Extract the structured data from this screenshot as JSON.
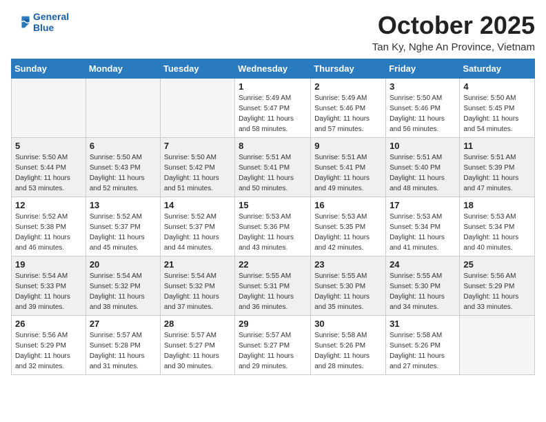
{
  "header": {
    "logo_line1": "General",
    "logo_line2": "Blue",
    "month": "October 2025",
    "location": "Tan Ky, Nghe An Province, Vietnam"
  },
  "weekdays": [
    "Sunday",
    "Monday",
    "Tuesday",
    "Wednesday",
    "Thursday",
    "Friday",
    "Saturday"
  ],
  "weeks": [
    {
      "shaded": false,
      "days": [
        {
          "num": "",
          "info": ""
        },
        {
          "num": "",
          "info": ""
        },
        {
          "num": "",
          "info": ""
        },
        {
          "num": "1",
          "info": "Sunrise: 5:49 AM\nSunset: 5:47 PM\nDaylight: 11 hours\nand 58 minutes."
        },
        {
          "num": "2",
          "info": "Sunrise: 5:49 AM\nSunset: 5:46 PM\nDaylight: 11 hours\nand 57 minutes."
        },
        {
          "num": "3",
          "info": "Sunrise: 5:50 AM\nSunset: 5:46 PM\nDaylight: 11 hours\nand 56 minutes."
        },
        {
          "num": "4",
          "info": "Sunrise: 5:50 AM\nSunset: 5:45 PM\nDaylight: 11 hours\nand 54 minutes."
        }
      ]
    },
    {
      "shaded": true,
      "days": [
        {
          "num": "5",
          "info": "Sunrise: 5:50 AM\nSunset: 5:44 PM\nDaylight: 11 hours\nand 53 minutes."
        },
        {
          "num": "6",
          "info": "Sunrise: 5:50 AM\nSunset: 5:43 PM\nDaylight: 11 hours\nand 52 minutes."
        },
        {
          "num": "7",
          "info": "Sunrise: 5:50 AM\nSunset: 5:42 PM\nDaylight: 11 hours\nand 51 minutes."
        },
        {
          "num": "8",
          "info": "Sunrise: 5:51 AM\nSunset: 5:41 PM\nDaylight: 11 hours\nand 50 minutes."
        },
        {
          "num": "9",
          "info": "Sunrise: 5:51 AM\nSunset: 5:41 PM\nDaylight: 11 hours\nand 49 minutes."
        },
        {
          "num": "10",
          "info": "Sunrise: 5:51 AM\nSunset: 5:40 PM\nDaylight: 11 hours\nand 48 minutes."
        },
        {
          "num": "11",
          "info": "Sunrise: 5:51 AM\nSunset: 5:39 PM\nDaylight: 11 hours\nand 47 minutes."
        }
      ]
    },
    {
      "shaded": false,
      "days": [
        {
          "num": "12",
          "info": "Sunrise: 5:52 AM\nSunset: 5:38 PM\nDaylight: 11 hours\nand 46 minutes."
        },
        {
          "num": "13",
          "info": "Sunrise: 5:52 AM\nSunset: 5:37 PM\nDaylight: 11 hours\nand 45 minutes."
        },
        {
          "num": "14",
          "info": "Sunrise: 5:52 AM\nSunset: 5:37 PM\nDaylight: 11 hours\nand 44 minutes."
        },
        {
          "num": "15",
          "info": "Sunrise: 5:53 AM\nSunset: 5:36 PM\nDaylight: 11 hours\nand 43 minutes."
        },
        {
          "num": "16",
          "info": "Sunrise: 5:53 AM\nSunset: 5:35 PM\nDaylight: 11 hours\nand 42 minutes."
        },
        {
          "num": "17",
          "info": "Sunrise: 5:53 AM\nSunset: 5:34 PM\nDaylight: 11 hours\nand 41 minutes."
        },
        {
          "num": "18",
          "info": "Sunrise: 5:53 AM\nSunset: 5:34 PM\nDaylight: 11 hours\nand 40 minutes."
        }
      ]
    },
    {
      "shaded": true,
      "days": [
        {
          "num": "19",
          "info": "Sunrise: 5:54 AM\nSunset: 5:33 PM\nDaylight: 11 hours\nand 39 minutes."
        },
        {
          "num": "20",
          "info": "Sunrise: 5:54 AM\nSunset: 5:32 PM\nDaylight: 11 hours\nand 38 minutes."
        },
        {
          "num": "21",
          "info": "Sunrise: 5:54 AM\nSunset: 5:32 PM\nDaylight: 11 hours\nand 37 minutes."
        },
        {
          "num": "22",
          "info": "Sunrise: 5:55 AM\nSunset: 5:31 PM\nDaylight: 11 hours\nand 36 minutes."
        },
        {
          "num": "23",
          "info": "Sunrise: 5:55 AM\nSunset: 5:30 PM\nDaylight: 11 hours\nand 35 minutes."
        },
        {
          "num": "24",
          "info": "Sunrise: 5:55 AM\nSunset: 5:30 PM\nDaylight: 11 hours\nand 34 minutes."
        },
        {
          "num": "25",
          "info": "Sunrise: 5:56 AM\nSunset: 5:29 PM\nDaylight: 11 hours\nand 33 minutes."
        }
      ]
    },
    {
      "shaded": false,
      "days": [
        {
          "num": "26",
          "info": "Sunrise: 5:56 AM\nSunset: 5:29 PM\nDaylight: 11 hours\nand 32 minutes."
        },
        {
          "num": "27",
          "info": "Sunrise: 5:57 AM\nSunset: 5:28 PM\nDaylight: 11 hours\nand 31 minutes."
        },
        {
          "num": "28",
          "info": "Sunrise: 5:57 AM\nSunset: 5:27 PM\nDaylight: 11 hours\nand 30 minutes."
        },
        {
          "num": "29",
          "info": "Sunrise: 5:57 AM\nSunset: 5:27 PM\nDaylight: 11 hours\nand 29 minutes."
        },
        {
          "num": "30",
          "info": "Sunrise: 5:58 AM\nSunset: 5:26 PM\nDaylight: 11 hours\nand 28 minutes."
        },
        {
          "num": "31",
          "info": "Sunrise: 5:58 AM\nSunset: 5:26 PM\nDaylight: 11 hours\nand 27 minutes."
        },
        {
          "num": "",
          "info": ""
        }
      ]
    }
  ]
}
